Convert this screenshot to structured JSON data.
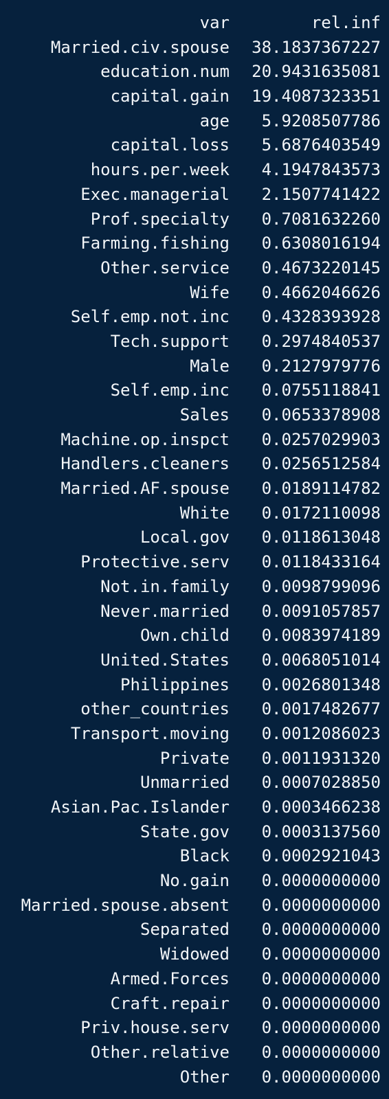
{
  "output": {
    "header": {
      "var": "var",
      "rel_inf": "rel.inf"
    },
    "rows": [
      {
        "var": "Married.civ.spouse",
        "rel_inf": "38.1837367227"
      },
      {
        "var": "education.num",
        "rel_inf": "20.9431635081"
      },
      {
        "var": "capital.gain",
        "rel_inf": "19.4087323351"
      },
      {
        "var": "age",
        "rel_inf": "5.9208507786"
      },
      {
        "var": "capital.loss",
        "rel_inf": "5.6876403549"
      },
      {
        "var": "hours.per.week",
        "rel_inf": "4.1947843573"
      },
      {
        "var": "Exec.managerial",
        "rel_inf": "2.1507741422"
      },
      {
        "var": "Prof.specialty",
        "rel_inf": "0.7081632260"
      },
      {
        "var": "Farming.fishing",
        "rel_inf": "0.6308016194"
      },
      {
        "var": "Other.service",
        "rel_inf": "0.4673220145"
      },
      {
        "var": "Wife",
        "rel_inf": "0.4662046626"
      },
      {
        "var": "Self.emp.not.inc",
        "rel_inf": "0.4328393928"
      },
      {
        "var": "Tech.support",
        "rel_inf": "0.2974840537"
      },
      {
        "var": "Male",
        "rel_inf": "0.2127979776"
      },
      {
        "var": "Self.emp.inc",
        "rel_inf": "0.0755118841"
      },
      {
        "var": "Sales",
        "rel_inf": "0.0653378908"
      },
      {
        "var": "Machine.op.inspct",
        "rel_inf": "0.0257029903"
      },
      {
        "var": "Handlers.cleaners",
        "rel_inf": "0.0256512584"
      },
      {
        "var": "Married.AF.spouse",
        "rel_inf": "0.0189114782"
      },
      {
        "var": "White",
        "rel_inf": "0.0172110098"
      },
      {
        "var": "Local.gov",
        "rel_inf": "0.0118613048"
      },
      {
        "var": "Protective.serv",
        "rel_inf": "0.0118433164"
      },
      {
        "var": "Not.in.family",
        "rel_inf": "0.0098799096"
      },
      {
        "var": "Never.married",
        "rel_inf": "0.0091057857"
      },
      {
        "var": "Own.child",
        "rel_inf": "0.0083974189"
      },
      {
        "var": "United.States",
        "rel_inf": "0.0068051014"
      },
      {
        "var": "Philippines",
        "rel_inf": "0.0026801348"
      },
      {
        "var": "other_countries",
        "rel_inf": "0.0017482677"
      },
      {
        "var": "Transport.moving",
        "rel_inf": "0.0012086023"
      },
      {
        "var": "Private",
        "rel_inf": "0.0011931320"
      },
      {
        "var": "Unmarried",
        "rel_inf": "0.0007028850"
      },
      {
        "var": "Asian.Pac.Islander",
        "rel_inf": "0.0003466238"
      },
      {
        "var": "State.gov",
        "rel_inf": "0.0003137560"
      },
      {
        "var": "Black",
        "rel_inf": "0.0002921043"
      },
      {
        "var": "No.gain",
        "rel_inf": "0.0000000000"
      },
      {
        "var": "Married.spouse.absent",
        "rel_inf": "0.0000000000"
      },
      {
        "var": "Separated",
        "rel_inf": "0.0000000000"
      },
      {
        "var": "Widowed",
        "rel_inf": "0.0000000000"
      },
      {
        "var": "Armed.Forces",
        "rel_inf": "0.0000000000"
      },
      {
        "var": "Craft.repair",
        "rel_inf": "0.0000000000"
      },
      {
        "var": "Priv.house.serv",
        "rel_inf": "0.0000000000"
      },
      {
        "var": "Other.relative",
        "rel_inf": "0.0000000000"
      },
      {
        "var": "Other",
        "rel_inf": "0.0000000000"
      }
    ]
  },
  "theme": {
    "background": "#06213d",
    "text": "#f2f5f8"
  }
}
